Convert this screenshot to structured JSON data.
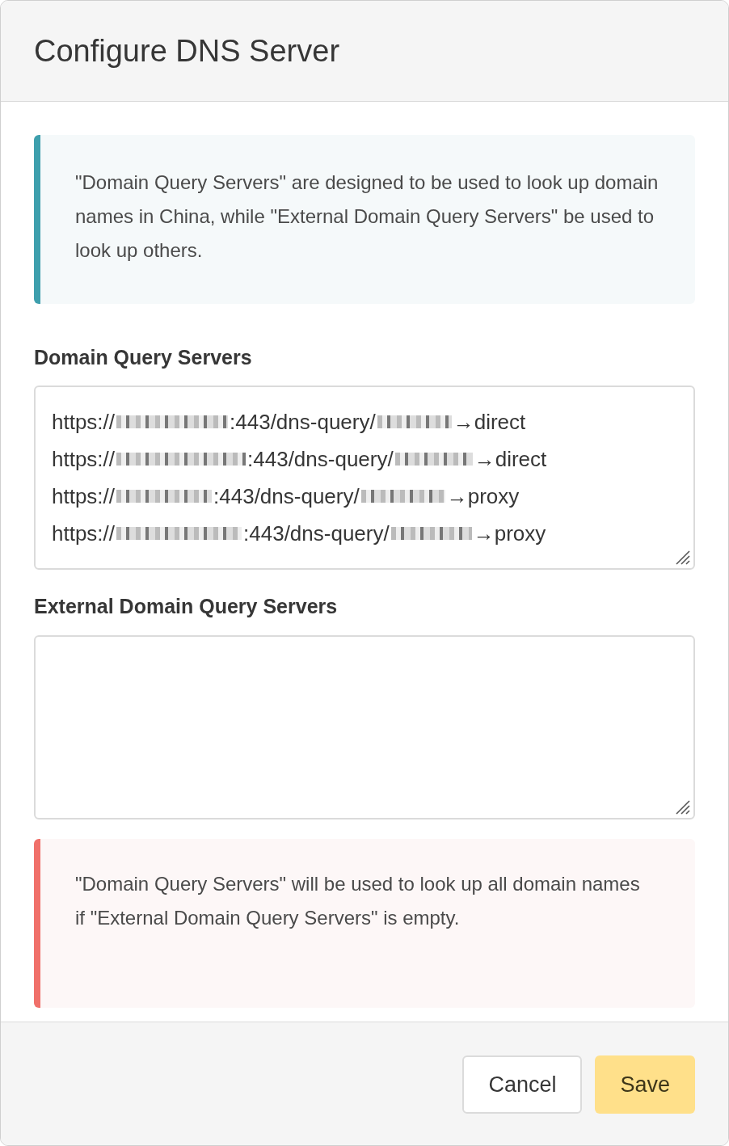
{
  "dialog": {
    "title": "Configure DNS Server"
  },
  "info_note": "\"Domain Query Servers\" are designed to be used to look up domain names in China, while \"External Domain Query Servers\" be used to look up others.",
  "domain_servers": {
    "label": "Domain Query Servers",
    "lines": [
      {
        "scheme": "https://",
        "path": ":443/dns-query/",
        "route": "→direct"
      },
      {
        "scheme": "https://",
        "path": ":443/dns-query/",
        "route": "→direct"
      },
      {
        "scheme": "https://",
        "path": ":443/dns-query/",
        "route": "→proxy"
      },
      {
        "scheme": "https://",
        "path": ":443/dns-query/",
        "route": "→proxy"
      }
    ]
  },
  "external_servers": {
    "label": "External Domain Query Servers"
  },
  "warning_note": "\"Domain Query Servers\" will be used to look up all domain names if \"External Domain Query Servers\" is empty.",
  "buttons": [
    {
      "kind": "secondary",
      "label": "Cancel"
    },
    {
      "kind": "primary",
      "label": "Save"
    }
  ]
}
